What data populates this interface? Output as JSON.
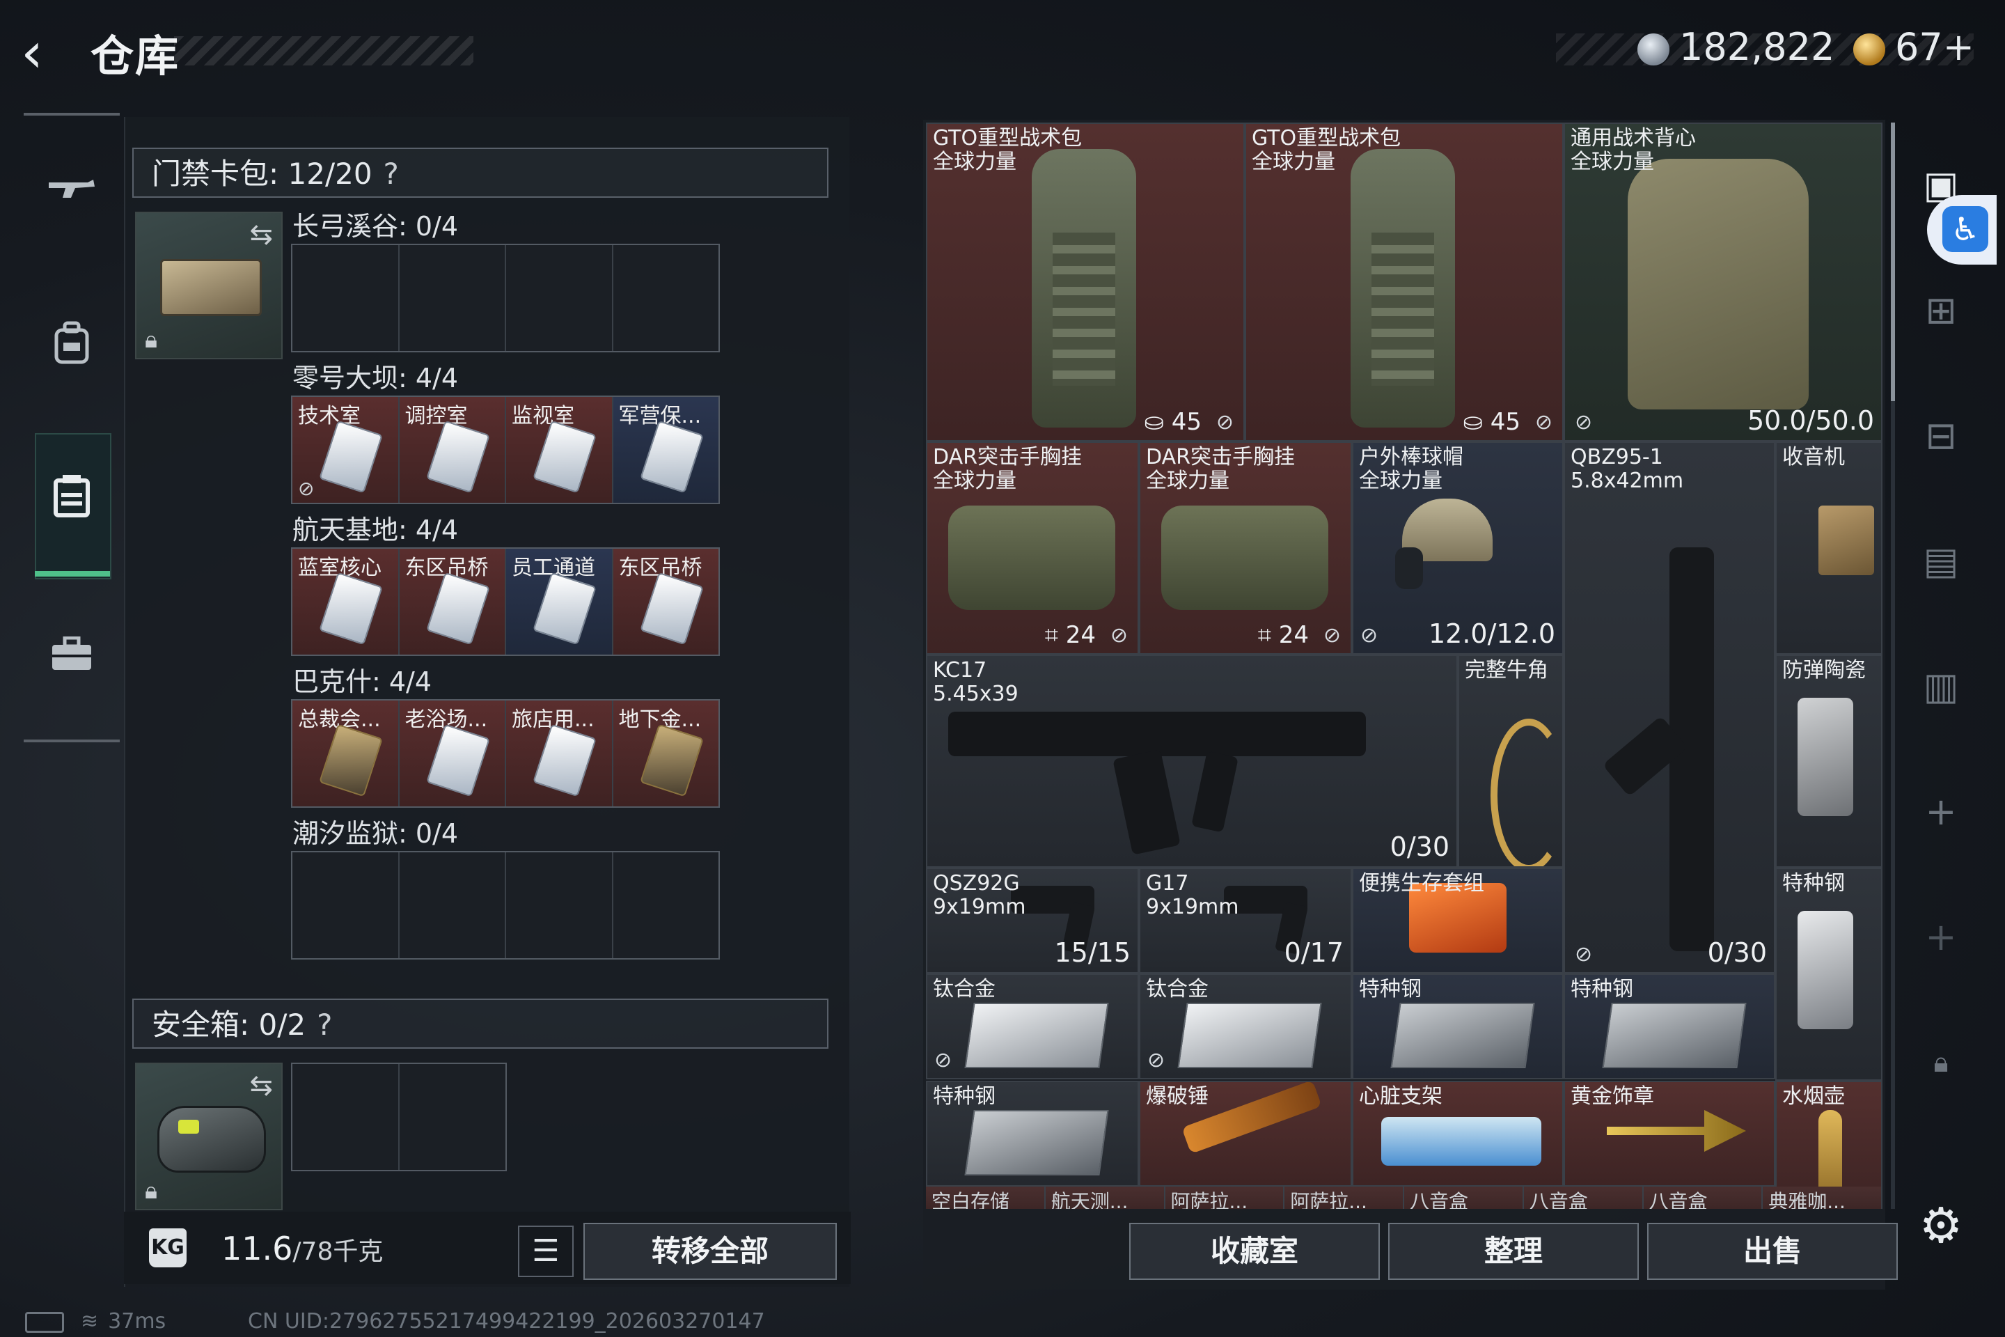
{
  "header": {
    "title": "仓库",
    "currency": "182,822",
    "coupons": "67+"
  },
  "nav": {
    "icons": [
      "gun-icon",
      "backpack-icon",
      "storage-box-icon",
      "briefcase-icon"
    ],
    "active": "storage-box-icon"
  },
  "keycard": {
    "header": "门禁卡包: 12/20",
    "help": "?",
    "zones": [
      {
        "label": "长弓溪谷: 0/4",
        "cells": [
          "",
          "",
          "",
          ""
        ]
      },
      {
        "label": "零号大坝: 4/4",
        "cells": [
          "技术室",
          "调控室",
          "监视室",
          "军营保..."
        ]
      },
      {
        "label": "航天基地: 4/4",
        "cells": [
          "蓝室核心",
          "东区吊桥",
          "员工通道",
          "东区吊桥"
        ]
      },
      {
        "label": "巴克什: 4/4",
        "cells": [
          "总裁会...",
          "老浴场...",
          "旅店用...",
          "地下金..."
        ]
      },
      {
        "label": "潮汐监狱: 0/4",
        "cells": [
          "",
          "",
          "",
          ""
        ]
      }
    ]
  },
  "safebox": {
    "header": "安全箱: 0/2",
    "help": "?"
  },
  "weight": {
    "value": "11.6",
    "capacity": "/78千克",
    "kg_icon": "KG"
  },
  "actions": {
    "list_icon": "☰",
    "transfer_all": "转移全部",
    "collection": "收藏室",
    "sort": "整理",
    "sell": "出售"
  },
  "inventory": {
    "items": [
      {
        "name": "GTO重型战术包\n全球力量",
        "count": "45"
      },
      {
        "name": "GTO重型战术包\n全球力量",
        "count": "45"
      },
      {
        "name": "通用战术背心\n全球力量",
        "count": "50.0/50.0"
      },
      {
        "name": "DAR突击手胸挂\n全球力量",
        "count": "24"
      },
      {
        "name": "DAR突击手胸挂\n全球力量",
        "count": "24"
      },
      {
        "name": "户外棒球帽\n全球力量",
        "count": "12.0/12.0"
      },
      {
        "name": "QBZ95-1\n5.8x42mm",
        "count": "0/30"
      },
      {
        "name": "收音机",
        "count": ""
      },
      {
        "name": "KC17\n5.45x39",
        "count": "0/30"
      },
      {
        "name": "完整牛角",
        "count": ""
      },
      {
        "name": "防弹陶瓷",
        "count": ""
      },
      {
        "name": "QSZ92G\n9x19mm",
        "count": "15/15"
      },
      {
        "name": "G17\n9x19mm",
        "count": "0/17"
      },
      {
        "name": "便携生存套组",
        "count": ""
      },
      {
        "name": "特种钢",
        "count": ""
      },
      {
        "name": "钛合金",
        "count": ""
      },
      {
        "name": "钛合金",
        "count": ""
      },
      {
        "name": "特种钢",
        "count": ""
      },
      {
        "name": "特种钢",
        "count": ""
      },
      {
        "name": "特种钢",
        "count": ""
      },
      {
        "name": "爆破锤",
        "count": ""
      },
      {
        "name": "心脏支架",
        "count": ""
      },
      {
        "name": "黄金饰章",
        "count": ""
      },
      {
        "name": "水烟壶",
        "count": ""
      }
    ],
    "partial_row": [
      "空白存储",
      "航天测...",
      "阿萨拉...",
      "阿萨拉...",
      "八音盒",
      "八音盒",
      "八音盒",
      "典雅咖..."
    ]
  },
  "status": {
    "ping": "37ms",
    "uid": "CN UID:2796275521749942219​9_202603270147"
  }
}
